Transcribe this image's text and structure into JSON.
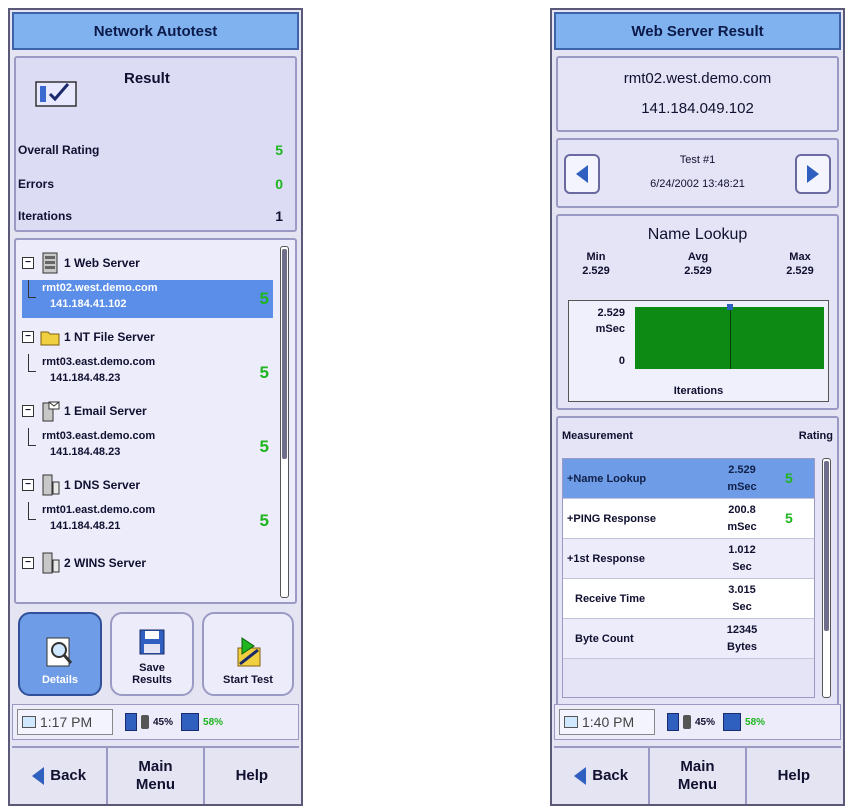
{
  "left": {
    "title": "Network Autotest",
    "result": {
      "title": "Result",
      "rows": [
        {
          "label": "Overall Rating",
          "value": "5",
          "color": "green"
        },
        {
          "label": "Errors",
          "value": "0",
          "color": "green"
        },
        {
          "label": "Iterations",
          "value": "1",
          "color": "black"
        }
      ]
    },
    "tree": [
      {
        "group": "1 Web Server",
        "icon": "web-server-icon",
        "host": "rmt02.west.demo.com",
        "ip": "141.184.41.102",
        "rating": "5",
        "selected": true
      },
      {
        "group": "1 NT File Server",
        "icon": "folder-icon",
        "host": "rmt03.east.demo.com",
        "ip": "141.184.48.23",
        "rating": "5",
        "selected": false
      },
      {
        "group": "1 Email Server",
        "icon": "email-server-icon",
        "host": "rmt03.east.demo.com",
        "ip": "141.184.48.23",
        "rating": "5",
        "selected": false
      },
      {
        "group": "1 DNS Server",
        "icon": "dns-server-icon",
        "host": "rmt01.east.demo.com",
        "ip": "141.184.48.21",
        "rating": "5",
        "selected": false
      },
      {
        "group": "2 WINS Server",
        "icon": "wins-server-icon"
      }
    ],
    "actions": {
      "details": "Details",
      "save_line1": "Save",
      "save_line2": "Results",
      "start": "Start Test"
    },
    "status": {
      "time": "1:17 PM",
      "battery": "45%",
      "disk": "58%"
    }
  },
  "right": {
    "title": "Web Server Result",
    "host": "rmt02.west.demo.com",
    "ip": "141.184.049.102",
    "test": {
      "label": "Test #1",
      "timestamp": "6/24/2002 13:48:21"
    },
    "lookup": {
      "title": "Name Lookup",
      "min_label": "Min",
      "min": "2.529",
      "avg_label": "Avg",
      "avg": "2.529",
      "max_label": "Max",
      "max": "2.529",
      "y_top": "2.529",
      "y_unit": "mSec",
      "y_bottom": "0",
      "x_label": "Iterations"
    },
    "measurements": {
      "col_measurement": "Measurement",
      "col_rating": "Rating",
      "rows": [
        {
          "name": "+Name Lookup",
          "value": "2.529",
          "unit": "mSec",
          "rating": "5",
          "style": "selected"
        },
        {
          "name": "+PING Response",
          "value": "200.8",
          "unit": "mSec",
          "rating": "5",
          "style": "alt"
        },
        {
          "name": "+1st Response",
          "value": "1.012",
          "unit": "Sec",
          "rating": "",
          "style": "plain"
        },
        {
          "name": "Receive Time",
          "value": "3.015",
          "unit": "Sec",
          "rating": "",
          "style": "alt"
        },
        {
          "name": "Byte Count",
          "value": "12345",
          "unit": "Bytes",
          "rating": "",
          "style": "plain"
        }
      ]
    },
    "status": {
      "time": "1:40 PM",
      "battery": "45%",
      "disk": "58%"
    }
  },
  "nav": {
    "back": "Back",
    "main_line1": "Main",
    "main_line2": "Menu",
    "help": "Help"
  },
  "colors": {
    "title_bar": "#7fb2ee",
    "selected_row": "#5a8ee8",
    "rating_green": "#1fb51f",
    "chart_fill": "#0c8a14"
  }
}
